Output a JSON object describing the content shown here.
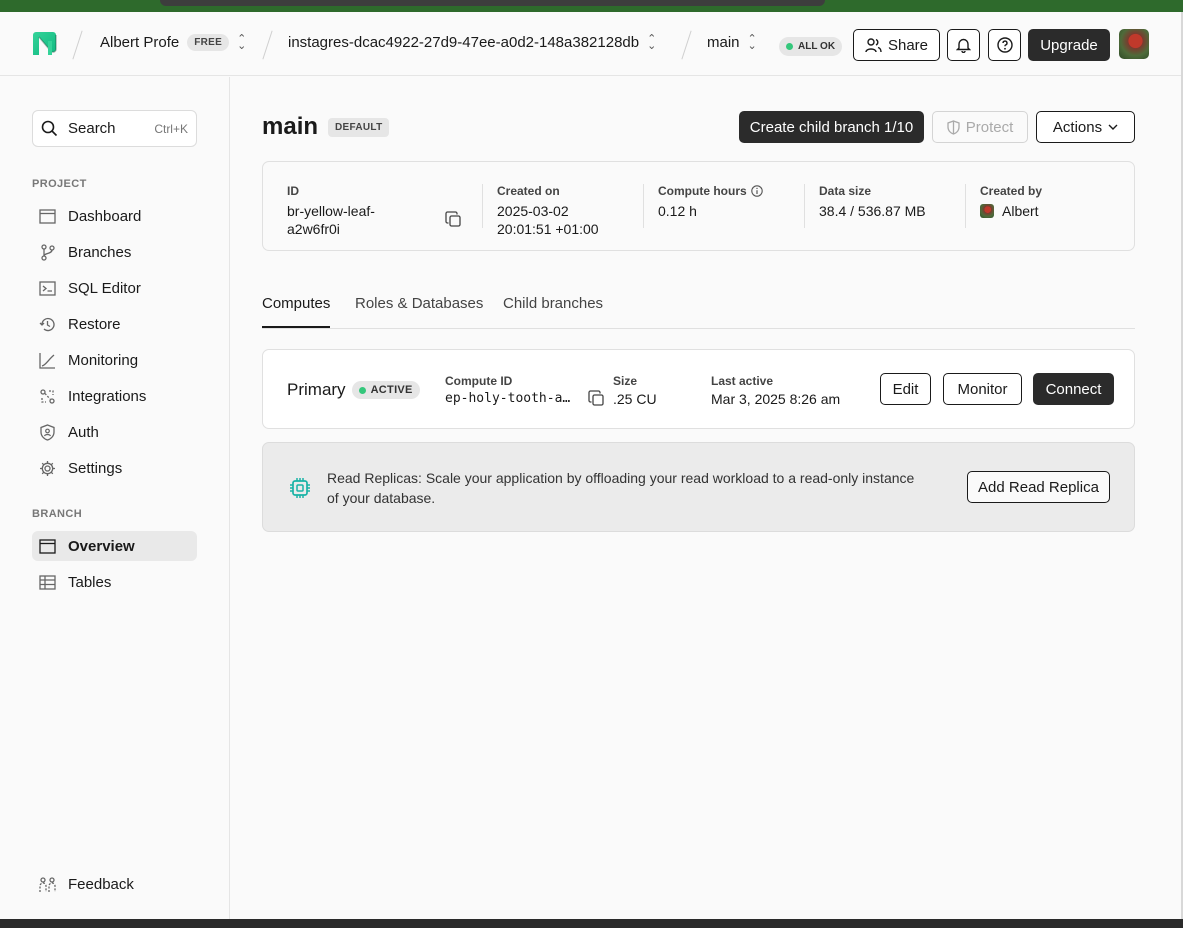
{
  "header": {
    "org_name": "Albert Profe",
    "org_plan": "FREE",
    "project_name": "instagres-dcac4922-27d9-47ee-a0d2-148a382128db",
    "branch_name": "main",
    "status": "ALL OK",
    "share_label": "Share",
    "upgrade_label": "Upgrade"
  },
  "sidebar": {
    "search_label": "Search",
    "search_shortcut": "Ctrl+K",
    "project_section": "PROJECT",
    "project_items": [
      {
        "label": "Dashboard",
        "icon": "dashboard-icon"
      },
      {
        "label": "Branches",
        "icon": "branches-icon"
      },
      {
        "label": "SQL Editor",
        "icon": "sql-editor-icon"
      },
      {
        "label": "Restore",
        "icon": "restore-icon"
      },
      {
        "label": "Monitoring",
        "icon": "monitoring-icon"
      },
      {
        "label": "Integrations",
        "icon": "integrations-icon"
      },
      {
        "label": "Auth",
        "icon": "auth-icon"
      },
      {
        "label": "Settings",
        "icon": "settings-icon"
      }
    ],
    "branch_section": "BRANCH",
    "branch_items": [
      {
        "label": "Overview",
        "icon": "overview-icon",
        "active": true
      },
      {
        "label": "Tables",
        "icon": "tables-icon"
      }
    ],
    "feedback_label": "Feedback"
  },
  "branch": {
    "title": "main",
    "badge": "DEFAULT",
    "create_child_label": "Create child branch 1/10",
    "protect_label": "Protect",
    "actions_label": "Actions",
    "info": {
      "id_label": "ID",
      "id_value_line1": "br-yellow-leaf-",
      "id_value_line2": "a2w6fr0i",
      "created_on_label": "Created on",
      "created_on_line1": "2025-03-02",
      "created_on_line2": "20:01:51 +01:00",
      "compute_hours_label": "Compute hours",
      "compute_hours_value": "0.12 h",
      "data_size_label": "Data size",
      "data_size_value": "38.4 / 536.87 MB",
      "created_by_label": "Created by",
      "created_by_value": "Albert"
    }
  },
  "tabs": [
    {
      "label": "Computes",
      "active": true
    },
    {
      "label": "Roles & Databases"
    },
    {
      "label": "Child branches"
    }
  ],
  "compute": {
    "name": "Primary",
    "status": "ACTIVE",
    "compute_id_label": "Compute ID",
    "compute_id_value": "ep-holy-tooth-a…",
    "size_label": "Size",
    "size_value": ".25 CU",
    "last_active_label": "Last active",
    "last_active_value": "Mar 3, 2025 8:26 am",
    "edit_label": "Edit",
    "monitor_label": "Monitor",
    "connect_label": "Connect"
  },
  "replica": {
    "text": "Read Replicas: Scale your application by offloading your read workload to a read-only instance of your database.",
    "button_label": "Add Read Replica"
  },
  "colors": {
    "accent_green": "#34c77b",
    "dark_button": "#2b2b2b",
    "replica_icon": "#19b3a6"
  }
}
